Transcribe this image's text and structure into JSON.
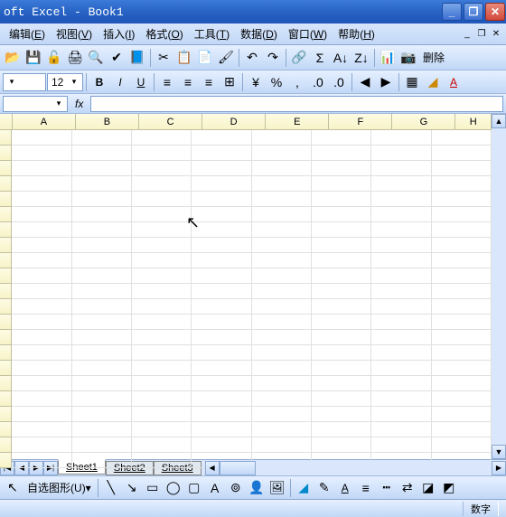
{
  "title": "oft Excel - Book1",
  "menus": {
    "edit": "编辑",
    "edit_u": "E",
    "view": "视图",
    "view_u": "V",
    "insert": "插入",
    "insert_u": "I",
    "format": "格式",
    "format_u": "O",
    "tools": "工具",
    "tools_u": "T",
    "data": "数据",
    "data_u": "D",
    "window": "窗口",
    "window_u": "W",
    "help": "帮助",
    "help_u": "H"
  },
  "toolbar": {
    "delete_label": "删除"
  },
  "format": {
    "font_size": "12"
  },
  "namebox": {
    "value": ""
  },
  "columns": [
    "A",
    "B",
    "C",
    "D",
    "E",
    "F",
    "G",
    "H"
  ],
  "sheets": {
    "tabs": [
      "Sheet1",
      "Sheet2",
      "Sheet3"
    ],
    "active": 0
  },
  "drawing": {
    "autoshape": "自选图形",
    "autoshape_u": "U"
  },
  "status": {
    "mode": "数字"
  },
  "formula": {
    "label": "fx"
  }
}
